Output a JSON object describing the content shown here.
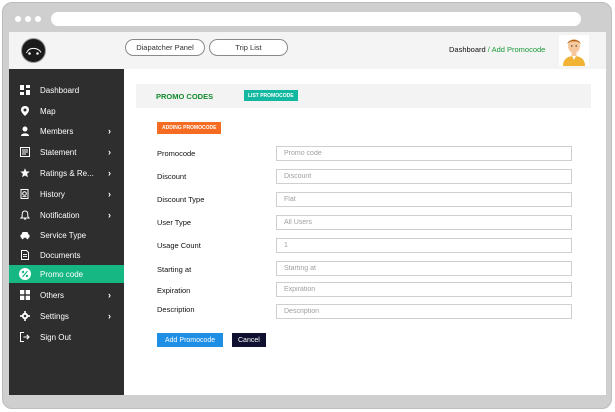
{
  "header": {
    "tabs": [
      "Diapatcher Panel",
      "Trip List"
    ],
    "breadcrumb": {
      "home": "Dashboard",
      "separator": "/",
      "current": "Add Promocode"
    }
  },
  "sidebar": {
    "items": [
      {
        "label": "Dashboard",
        "icon": "dashboard-icon",
        "chevron": ""
      },
      {
        "label": "Map",
        "icon": "map-pin-icon",
        "chevron": ""
      },
      {
        "label": "Members",
        "icon": "user-icon",
        "chevron": "›"
      },
      {
        "label": "Statement",
        "icon": "statement-icon",
        "chevron": "›"
      },
      {
        "label": "Ratings & Re...",
        "icon": "star-icon",
        "chevron": "›"
      },
      {
        "label": "History",
        "icon": "history-icon",
        "chevron": "›"
      },
      {
        "label": "Notification",
        "icon": "bell-icon",
        "chevron": "›"
      },
      {
        "label": "Service Type",
        "icon": "car-icon",
        "chevron": ""
      },
      {
        "label": "Documents",
        "icon": "document-icon",
        "chevron": ""
      },
      {
        "label": "Promo code",
        "icon": "percent-icon",
        "chevron": "",
        "active": true
      },
      {
        "label": "Others",
        "icon": "grid-icon",
        "chevron": "›"
      },
      {
        "label": "Settings",
        "icon": "gear-icon",
        "chevron": "›"
      },
      {
        "label": "Sign Out",
        "icon": "sign-out-icon",
        "chevron": ""
      }
    ]
  },
  "main": {
    "title": "PROMO CODES",
    "list_button": "LIST PROMOCODE",
    "section_badge": "ADDING PROMOCODE",
    "fields": [
      {
        "label": "Promocode",
        "placeholder": "Promo code"
      },
      {
        "label": "Discount",
        "placeholder": "Discount"
      },
      {
        "label": "Discount Type",
        "placeholder": "Flat"
      },
      {
        "label": "User Type",
        "placeholder": "All Users"
      },
      {
        "label": "Usage Count",
        "placeholder": "1"
      },
      {
        "label": "Starting at",
        "placeholder": "Starting at"
      },
      {
        "label": "Expiration",
        "placeholder": "Expiration"
      },
      {
        "label": "Description",
        "placeholder": "Description"
      }
    ],
    "submit_label": "Add Promocode",
    "cancel_label": "Cancel"
  },
  "colors": {
    "sidebar_bg": "#2e2e2e",
    "active_item": "#17b784",
    "title_green": "#138a2e",
    "list_button": "#13b8a0",
    "badge_orange": "#f46b21",
    "submit_blue": "#1f8fe6",
    "cancel_navy": "#0f1030"
  }
}
